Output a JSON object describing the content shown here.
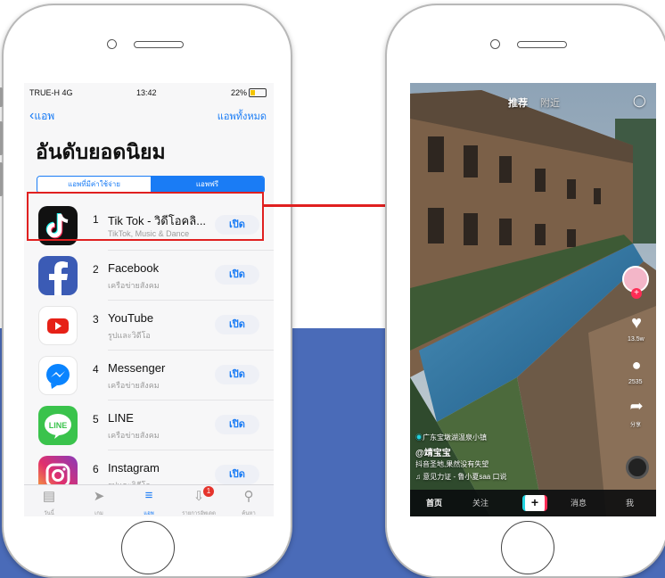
{
  "left_phone": {
    "status": {
      "carrier": "TRUE-H 4G",
      "time": "13:42",
      "battery": "22%"
    },
    "nav": {
      "back_label": "แอพ",
      "see_all_label": "แอพทั้งหมด"
    },
    "title": "อันดับยอดนิยม",
    "segment": {
      "paid_label": "แอพที่มีค่าใช้จ่าย",
      "free_label": "แอพฟรี"
    },
    "apps": [
      {
        "rank": "1",
        "name": "Tik Tok - วิดีโอคลิ...",
        "category": "TikTok, Music & Dance",
        "button": "เปิด",
        "icon": "tiktok-icon"
      },
      {
        "rank": "2",
        "name": "Facebook",
        "category": "เครือข่ายสังคม",
        "button": "เปิด",
        "icon": "facebook-icon"
      },
      {
        "rank": "3",
        "name": "YouTube",
        "category": "รูปและวิดีโอ",
        "button": "เปิด",
        "icon": "youtube-icon"
      },
      {
        "rank": "4",
        "name": "Messenger",
        "category": "เครือข่ายสังคม",
        "button": "เปิด",
        "icon": "messenger-icon"
      },
      {
        "rank": "5",
        "name": "LINE",
        "category": "เครือข่ายสังคม",
        "button": "เปิด",
        "icon": "line-icon"
      },
      {
        "rank": "6",
        "name": "Instagram",
        "category": "รูปและวิดีโอ",
        "button": "เปิด",
        "icon": "instagram-icon"
      }
    ],
    "tabs": [
      {
        "label": "วันนี้",
        "icon": "today-icon",
        "active": false
      },
      {
        "label": "เกม",
        "icon": "rocket-icon",
        "active": false
      },
      {
        "label": "แอพ",
        "icon": "apps-stack-icon",
        "active": true
      },
      {
        "label": "รายการอัพเดต",
        "icon": "updates-icon",
        "active": false,
        "badge": "1"
      },
      {
        "label": "ค้นหา",
        "icon": "search-icon",
        "active": false
      }
    ]
  },
  "right_phone": {
    "top_tabs": {
      "recommended": "推荐",
      "nearby": "附近"
    },
    "location_tag": "广东宝墩湖温泉小镇",
    "username": "@靖宝宝",
    "caption": "抖音圣地,果然没有失望",
    "music": "意见力证 - 鲁小夏saa 口说",
    "likes": "13.5w",
    "comments": "2535",
    "share_label": "分享",
    "bottom_tabs": {
      "home": "首页",
      "follow": "关注",
      "add": "+",
      "messages": "消息",
      "me": "我"
    }
  },
  "colors": {
    "accent_blue": "#1a7cf5",
    "highlight_red": "#e02020",
    "background_band": "#4a6bb8"
  }
}
